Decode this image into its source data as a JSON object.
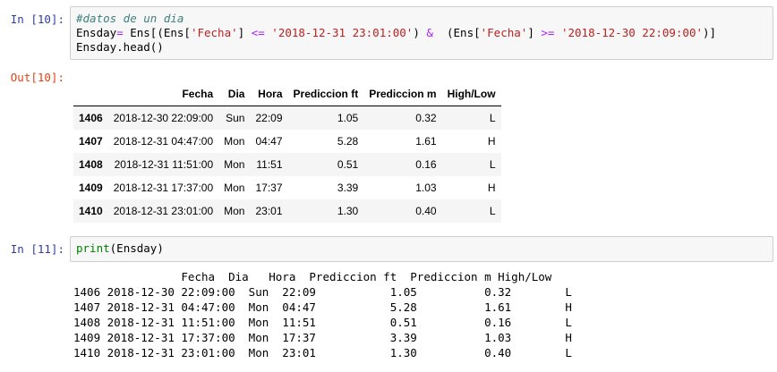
{
  "cell1": {
    "prompt": "In [10]:",
    "comment": "#datos de un dia",
    "line2": {
      "p1": "Ensday",
      "op1": "=",
      "p2": " Ens[(Ens[",
      "s1": "'Fecha'",
      "p3": "] ",
      "op2": "<=",
      "p4": " ",
      "s2": "'2018-12-31 23:01:00'",
      "p5": ") ",
      "op3": "&",
      "p6": "  (Ens[",
      "s3": "'Fecha'",
      "p7": "] ",
      "op4": ">=",
      "p8": " ",
      "s4": "'2018-12-30 22:09:00'",
      "p9": ")]"
    },
    "line3": "Ensday.head()"
  },
  "out1": {
    "prompt": "Out[10]:",
    "columns": [
      "",
      "Fecha",
      "Dia",
      "Hora",
      "Prediccion ft",
      "Prediccion m",
      "High/Low"
    ],
    "rows": [
      {
        "idx": "1406",
        "fecha": "2018-12-30 22:09:00",
        "dia": "Sun",
        "hora": "22:09",
        "ft": "1.05",
        "m": "0.32",
        "hl": "L"
      },
      {
        "idx": "1407",
        "fecha": "2018-12-31 04:47:00",
        "dia": "Mon",
        "hora": "04:47",
        "ft": "5.28",
        "m": "1.61",
        "hl": "H"
      },
      {
        "idx": "1408",
        "fecha": "2018-12-31 11:51:00",
        "dia": "Mon",
        "hora": "11:51",
        "ft": "0.51",
        "m": "0.16",
        "hl": "L"
      },
      {
        "idx": "1409",
        "fecha": "2018-12-31 17:37:00",
        "dia": "Mon",
        "hora": "17:37",
        "ft": "3.39",
        "m": "1.03",
        "hl": "H"
      },
      {
        "idx": "1410",
        "fecha": "2018-12-31 23:01:00",
        "dia": "Mon",
        "hora": "23:01",
        "ft": "1.30",
        "m": "0.40",
        "hl": "L"
      }
    ]
  },
  "cell2": {
    "prompt": "In [11]:",
    "fn": "print",
    "args": "(Ensday)"
  },
  "out2": {
    "lines": [
      "                Fecha  Dia   Hora  Prediccion ft  Prediccion m High/Low",
      "1406 2018-12-30 22:09:00  Sun  22:09           1.05          0.32        L",
      "1407 2018-12-31 04:47:00  Mon  04:47           5.28          1.61        H",
      "1408 2018-12-31 11:51:00  Mon  11:51           0.51          0.16        L",
      "1409 2018-12-31 17:37:00  Mon  17:37           3.39          1.03        H",
      "1410 2018-12-31 23:01:00  Mon  23:01           1.30          0.40        L"
    ]
  }
}
